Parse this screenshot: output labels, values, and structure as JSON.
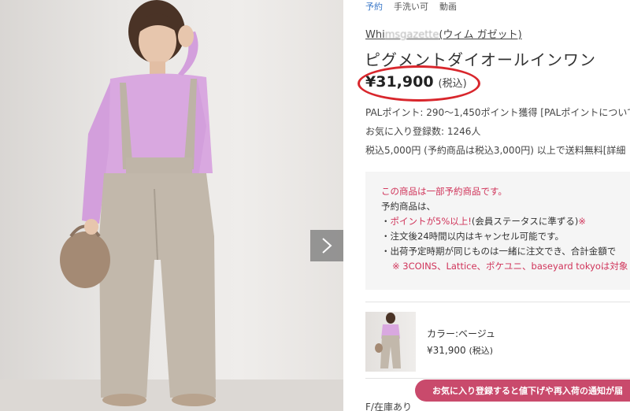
{
  "tags": [
    "予約",
    "手洗い可",
    "動画"
  ],
  "brand": {
    "prefix": "Whi",
    "obscured": "msgazette",
    "suffix": "(ウィム ガゼット)"
  },
  "product": {
    "title": "ピグメントダイオールインワン",
    "price": "¥31,900",
    "tax_label": "(税込)"
  },
  "meta": {
    "points": "PALポイント: 290〜1,450ポイント獲得 [PALポイントについて",
    "favorites": "お気に入り登録数: 1246人",
    "shipping": "税込5,000円 (予約商品は税込3,000円) 以上で送料無料[詳細"
  },
  "notice": {
    "line1": "この商品は一部予約商品です。",
    "line2": "予約商品は、",
    "line3_prefix": "・",
    "line3_red": "ポイントが5%以上!",
    "line3_rest": "(会員ステータスに準ずる)",
    "line3_mark": "※",
    "line4": "・注文後24時間以内はキャンセル可能です。",
    "line5": "・出荷予定時期が同じものは一緒に注文でき、合計金額で",
    "line6": "※ 3COINS、Lattice、ポケユニ、baseyard tokyoは対象"
  },
  "variant": {
    "color": "カラー:ベージュ",
    "price": "¥31,900",
    "tax_label": "(税込)"
  },
  "stock_label": "F/在庫あり",
  "fav_banner": "お気に入り登録すると値下げや再入荷の通知が届",
  "colors": {
    "accent_red": "#d8262c",
    "notice_red": "#d0345a",
    "banner": "#c94a6c",
    "tag_blue": "#3a78c8"
  }
}
